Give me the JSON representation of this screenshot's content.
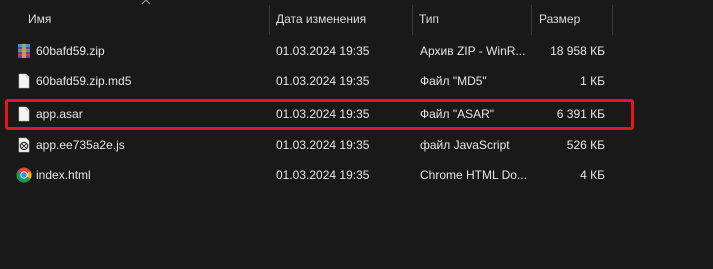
{
  "columns": {
    "name": "Имя",
    "date": "Дата изменения",
    "type": "Тип",
    "size": "Размер"
  },
  "files": [
    {
      "name": "60bafd59.zip",
      "date": "01.03.2024 19:35",
      "type": "Архив ZIP - WinR...",
      "size": "18 958 КБ",
      "icon": "winrar-archive-icon"
    },
    {
      "name": "60bafd59.zip.md5",
      "date": "01.03.2024 19:35",
      "type": "Файл \"MD5\"",
      "size": "1 КБ",
      "icon": "blank-file-icon"
    },
    {
      "name": "app.asar",
      "date": "01.03.2024 19:35",
      "type": "Файл \"ASAR\"",
      "size": "6 391 КБ",
      "icon": "blank-file-icon"
    },
    {
      "name": "app.ee735a2e.js",
      "date": "01.03.2024 19:35",
      "type": "файл JavaScript",
      "size": "526 КБ",
      "icon": "javascript-file-icon"
    },
    {
      "name": "index.html",
      "date": "01.03.2024 19:35",
      "type": "Chrome HTML Do...",
      "size": "4 КБ",
      "icon": "chrome-icon"
    }
  ],
  "colors": {
    "background": "#191919",
    "highlight_border": "#e8161c",
    "text": "#e6e6e6"
  }
}
